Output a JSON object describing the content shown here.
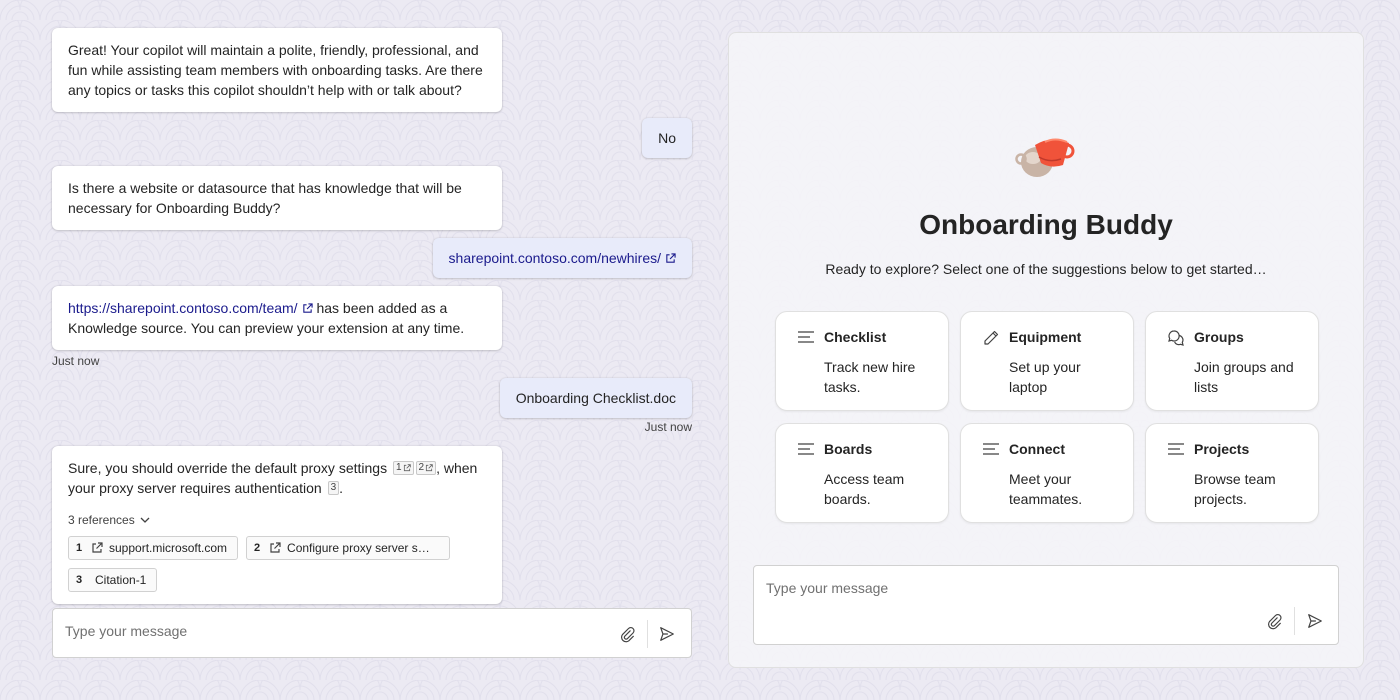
{
  "chat": {
    "messages": {
      "m1": {
        "text": "Great! Your copilot will maintain a polite, friendly, professional, and fun while assisting team members with onboarding tasks. Are there any topics or tasks this copilot shouldn’t help with or talk about?"
      },
      "m2": {
        "text": "No"
      },
      "m3": {
        "text": "Is there a website or datasource that has knowledge that will be necessary for Onboarding Buddy?"
      },
      "m4": {
        "link": "sharepoint.contoso.com/newhires/"
      },
      "m5": {
        "link": "https://sharepoint.contoso.com/team/",
        "text": " has been added as a Knowledge source. You can preview your extension at any time.",
        "timestamp": "Just now"
      },
      "m6": {
        "text": "Onboarding Checklist.doc",
        "timestamp": "Just now"
      },
      "m7": {
        "text_a": "Sure, you should override the default proxy settings ",
        "cite1": "1",
        "cite2": "2",
        "text_b": ", when your proxy server requires authentication ",
        "cite3": "3",
        "text_c": ".",
        "references_label": "3 references",
        "references": [
          {
            "num": "1",
            "label": "support.microsoft.com",
            "icon": "open-external-icon"
          },
          {
            "num": "2",
            "label": "Configure proxy server s…",
            "icon": "open-external-icon"
          },
          {
            "num": "3",
            "label": "Citation-1"
          }
        ]
      }
    },
    "composer": {
      "placeholder": "Type your message",
      "attach_icon": "paperclip-icon",
      "send_icon": "send-icon"
    }
  },
  "panel": {
    "logo": "onboarding-buddy-logo",
    "title": "Onboarding Buddy",
    "subtitle": "Ready to explore? Select one of the suggestions below to get started…",
    "cards": [
      {
        "title": "Checklist",
        "desc": "Track new hire tasks.",
        "icon": "text-lines-icon"
      },
      {
        "title": "Equipment",
        "desc": "Set up your laptop",
        "icon": "pencil-icon"
      },
      {
        "title": "Groups",
        "desc": "Join groups and lists",
        "icon": "chat-bubbles-icon"
      },
      {
        "title": "Boards",
        "desc": "Access team boards.",
        "icon": "text-lines-icon"
      },
      {
        "title": "Connect",
        "desc": "Meet your teammates.",
        "icon": "text-lines-icon"
      },
      {
        "title": "Projects",
        "desc": "Browse team projects.",
        "icon": "text-lines-icon"
      }
    ],
    "composer": {
      "placeholder": "Type your message",
      "attach_icon": "paperclip-icon",
      "send_icon": "send-icon"
    }
  },
  "colors": {
    "background": "#eceaf3",
    "user_bubble": "#e8ebfa",
    "link": "#1a1a8c",
    "logo_accent": "#f0533a"
  }
}
